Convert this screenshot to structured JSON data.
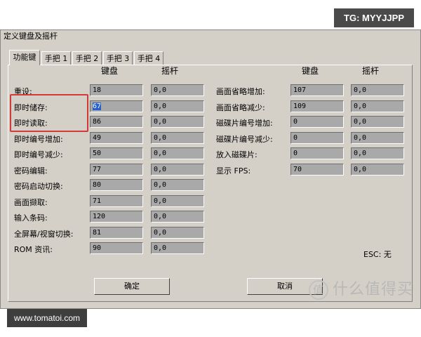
{
  "watermarks": {
    "top": "TG: MYYJJPP",
    "bottom": "www.tomatoi.com",
    "smzdm_glyph": "值",
    "smzdm_text": "什么值得买"
  },
  "window": {
    "title": "定义键盘及摇杆"
  },
  "tabs": [
    {
      "label": "功能键",
      "active": true
    },
    {
      "label": "手把 1"
    },
    {
      "label": "手把 2"
    },
    {
      "label": "手把 3"
    },
    {
      "label": "手把 4"
    }
  ],
  "columns": {
    "keyboard": "键盘",
    "joystick": "摇杆"
  },
  "left_rows": [
    {
      "label": "重设:",
      "key": "18",
      "joy": "0,0"
    },
    {
      "label": "即时储存:",
      "key": "67",
      "joy": "0,0",
      "selected": true
    },
    {
      "label": "即时读取:",
      "key": "86",
      "joy": "0,0"
    },
    {
      "label": "即时编号增加:",
      "key": "49",
      "joy": "0,0"
    },
    {
      "label": "即时编号减少:",
      "key": "50",
      "joy": "0,0"
    },
    {
      "label": "密码编辑:",
      "key": "77",
      "joy": "0,0"
    },
    {
      "label": "密码启动切换:",
      "key": "80",
      "joy": "0,0"
    },
    {
      "label": "画面撷取:",
      "key": "71",
      "joy": "0,0"
    },
    {
      "label": "输入条码:",
      "key": "120",
      "joy": "0,0"
    },
    {
      "label": "全屏幕/视窗切换:",
      "key": "81",
      "joy": "0,0"
    },
    {
      "label": "ROM 资讯:",
      "key": "90",
      "joy": "0,0"
    }
  ],
  "right_rows": [
    {
      "label": "画面省略增加:",
      "key": "107",
      "joy": "0,0"
    },
    {
      "label": "画面省略减少:",
      "key": "109",
      "joy": "0,0"
    },
    {
      "label": "磁碟片编号增加:",
      "key": "0",
      "joy": "0,0"
    },
    {
      "label": "磁碟片编号减少:",
      "key": "0",
      "joy": "0,0"
    },
    {
      "label": "放入磁碟片:",
      "key": "0",
      "joy": "0,0"
    },
    {
      "label": "显示 FPS:",
      "key": "70",
      "joy": "0,0"
    }
  ],
  "esc_label": "ESC: 无",
  "buttons": {
    "ok": "确定",
    "cancel": "取消"
  }
}
